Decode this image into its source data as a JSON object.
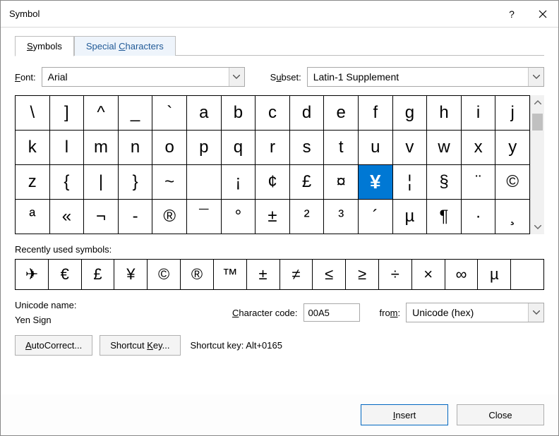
{
  "title": "Symbol",
  "tabs": {
    "symbols": "Symbols",
    "special": "Special Characters"
  },
  "font": {
    "label": "Font:",
    "value": "Arial"
  },
  "subset": {
    "label": "Subset:",
    "value": "Latin-1 Supplement"
  },
  "grid_selected_char": "¥",
  "grid_rows": [
    [
      "\\",
      "]",
      "^",
      "_",
      "`",
      "a",
      "b",
      "c",
      "d",
      "e",
      "f",
      "g",
      "h",
      "i",
      "j"
    ],
    [
      "k",
      "l",
      "m",
      "n",
      "o",
      "p",
      "q",
      "r",
      "s",
      "t",
      "u",
      "v",
      "w",
      "x",
      "y"
    ],
    [
      "z",
      "{",
      "|",
      "}",
      "~",
      "",
      "¡",
      "¢",
      "£",
      "¤",
      "¥",
      "¦",
      "§",
      "¨",
      "©"
    ],
    [
      "ª",
      "«",
      "¬",
      "-",
      "®",
      "¯",
      "°",
      "±",
      "²",
      "³",
      "´",
      "µ",
      "¶",
      "·",
      "¸"
    ]
  ],
  "recent_label": "Recently used symbols:",
  "recent": [
    "✈",
    "€",
    "£",
    "¥",
    "©",
    "®",
    "™",
    "±",
    "≠",
    "≤",
    "≥",
    "÷",
    "×",
    "∞",
    "µ",
    ""
  ],
  "uname_label": "Unicode name:",
  "uname_value": "Yen Sign",
  "charcode_label": "Character code:",
  "charcode_value": "00A5",
  "from_label": "from:",
  "from_value": "Unicode (hex)",
  "autocorrect_btn": "AutoCorrect...",
  "shortcutkey_btn": "Shortcut Key...",
  "shortcut_text": "Shortcut key: Alt+0165",
  "insert_btn": "Insert",
  "close_btn": "Close",
  "help_glyph": "?"
}
